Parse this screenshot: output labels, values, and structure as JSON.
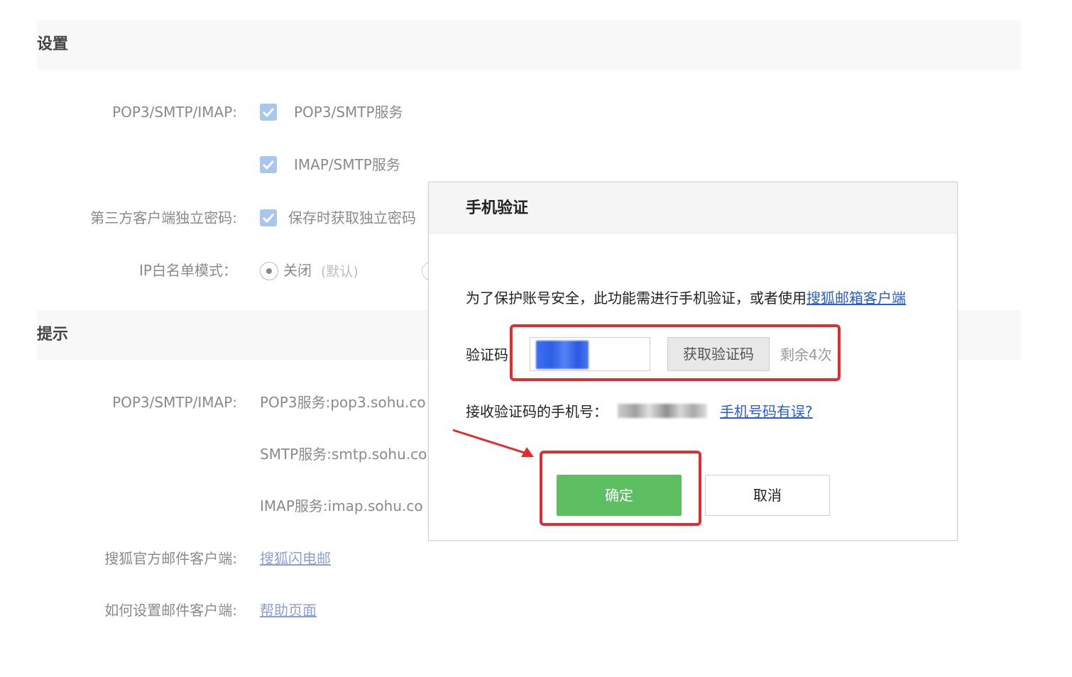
{
  "settings": {
    "title": "设置",
    "pop_label": "POP3/SMTP/IMAP:",
    "pop_option": "POP3/SMTP服务",
    "imap_option": "IMAP/SMTP服务",
    "third_party_label": "第三方客户端独立密码:",
    "third_party_option": "保存时获取独立密码",
    "ip_label": "IP白名单模式：",
    "ip_option": "关闭",
    "ip_option_note": "(默认)"
  },
  "tips": {
    "title": "提示",
    "pop_label": "POP3/SMTP/IMAP:",
    "pop_server": "POP3服务:pop3.sohu.co",
    "smtp_server": "SMTP服务:smtp.sohu.co",
    "imap_server": "IMAP服务:imap.sohu.co",
    "client_label": "搜狐官方邮件客户端:",
    "client_link": "搜狐闪电邮",
    "help_label": "如何设置邮件客户端:",
    "help_link": "帮助页面"
  },
  "dialog": {
    "title": "手机验证",
    "message": "为了保护账号安全，此功能需进行手机验证，或者使用",
    "message_link": "搜狐邮箱客户端",
    "code_label": "验证码",
    "get_code_button": "获取验证码",
    "remaining": "剩余4次",
    "phone_label": "接收验证码的手机号：",
    "phone_error_link": "手机号码有误?",
    "ok_button": "确定",
    "cancel_button": "取消"
  },
  "colors": {
    "accent_green": "#5dbf62",
    "link_blue": "#2a5cd6",
    "highlight_red": "#e02d2d"
  }
}
